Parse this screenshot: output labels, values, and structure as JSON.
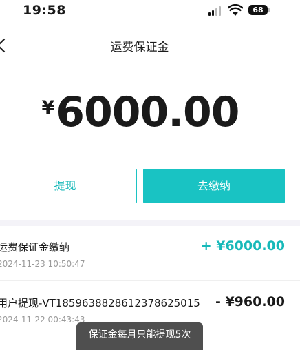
{
  "status_bar": {
    "time": "19:58",
    "battery_level": "68"
  },
  "header": {
    "title": "运费保证金"
  },
  "balance": {
    "currency_symbol": "¥",
    "amount": "6000.00"
  },
  "actions": {
    "withdraw_label": "提现",
    "pay_label": "去缴纳"
  },
  "records": [
    {
      "title": "运费保证金缴纳",
      "time": "2024-11-23 10:50:47",
      "amount": "+ ¥6000.00",
      "direction": "in"
    },
    {
      "title": "用户提现-VT185963882861237862501​5",
      "time": "2024-11-22 00:43:43",
      "amount": "- ¥960.00",
      "direction": "out"
    }
  ],
  "toast": {
    "text": "保证金每月只能提现5次"
  },
  "colors": {
    "accent": "#19c3c3",
    "divider": "#f4f3f8",
    "muted_text": "#9a9a9a"
  }
}
